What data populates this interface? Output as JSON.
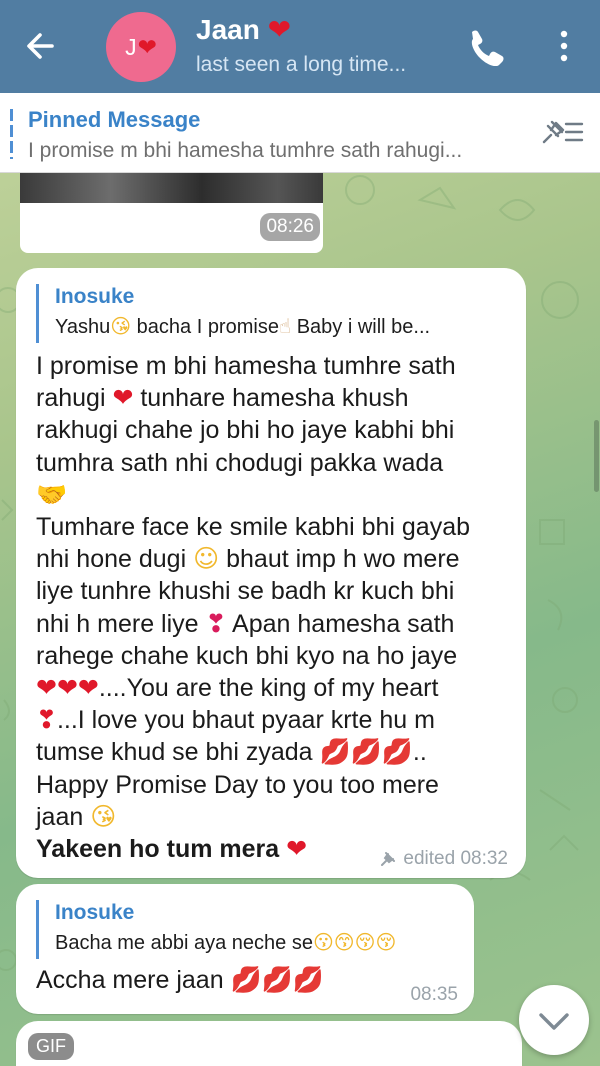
{
  "header": {
    "avatar_initial": "J",
    "contact_name": "Jaan",
    "status": "last seen a long time..."
  },
  "pinned": {
    "title": "Pinned Message",
    "text": "I promise m bhi hamesha tumhre sath rahugi..."
  },
  "media_message": {
    "time": "08:26"
  },
  "message_main": {
    "reply_name": "Inosuke",
    "reply_text_1": "Yashu",
    "reply_text_2": " bacha I promise",
    "reply_text_3": "  Baby i will be...",
    "lines": {
      "l1": "I promise m bhi hamesha tumhre sath",
      "l2a": "rahugi ",
      "l2b": " tunhare hamesha khush",
      "l3": "rakhugi chahe jo bhi ho jaye kabhi bhi",
      "l4": "tumhra sath nhi chodugi pakka wada",
      "l6": "Tumhare face ke smile kabhi bhi gayab",
      "l7a": "nhi hone dugi ",
      "l7b": " bhaut imp h wo mere",
      "l8": "liye tunhre khushi se badh kr kuch bhi",
      "l9a": "nhi h mere liye ",
      "l9b": "  Apan hamesha sath",
      "l10": "rahege chahe kuch bhi kyo na ho jaye",
      "l11": "....You are the king of my heart",
      "l12": "...I love you bhaut pyaar krte hu m",
      "l13a": "tumse khud se bhi zyada ",
      "l13b": "..",
      "l14": "Happy Promise Day to you too mere",
      "l15": "jaan ",
      "l16": "Yakeen ho tum mera "
    },
    "meta": "edited 08:32"
  },
  "message_second": {
    "reply_name": "Inosuke",
    "reply_text": "Bacha me abbi aya neche se",
    "text": "Accha mere jaan ",
    "time": "08:35"
  },
  "gif_message": {
    "badge": "GIF"
  },
  "colors": {
    "header_bg": "#517da2",
    "accent_blue": "#3a83c8",
    "heart_red": "#e0182a"
  },
  "icons": [
    "arrow-back-icon",
    "phone-icon",
    "more-vertical-icon",
    "pin-list-icon",
    "pin-icon",
    "chevron-down-icon"
  ]
}
